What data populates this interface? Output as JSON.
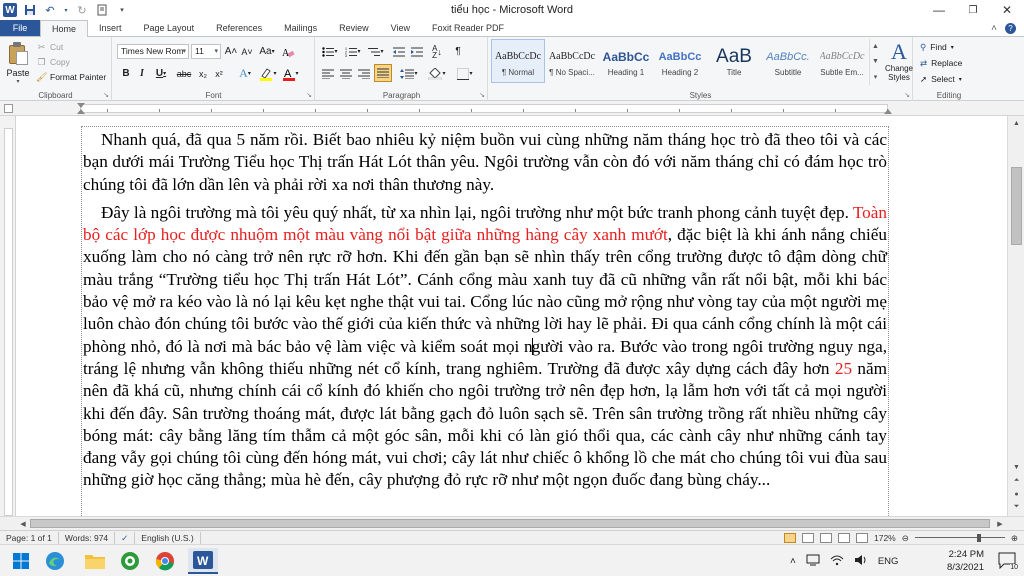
{
  "window": {
    "title": "tiểu học - Microsoft Word",
    "minimize": "—",
    "maximize": "❐",
    "close": "✕"
  },
  "qat": {
    "save_icon": "save-icon",
    "undo_icon": "undo-icon",
    "redo_icon": "redo-icon"
  },
  "tabs": [
    {
      "label": "File"
    },
    {
      "label": "Home"
    },
    {
      "label": "Insert"
    },
    {
      "label": "Page Layout"
    },
    {
      "label": "References"
    },
    {
      "label": "Mailings"
    },
    {
      "label": "Review"
    },
    {
      "label": "View"
    },
    {
      "label": "Foxit Reader PDF"
    }
  ],
  "clipboard": {
    "paste": "Paste",
    "cut": "Cut",
    "copy": "Copy",
    "format_painter": "Format Painter",
    "group_label": "Clipboard"
  },
  "font": {
    "name": "Times New Rom",
    "size": "11",
    "bold": "B",
    "italic": "I",
    "underline": "U",
    "strikethrough": "abc",
    "subscript": "x₂",
    "superscript": "x²",
    "grow": "A˄",
    "shrink": "A˅",
    "change_case": "Aa",
    "group_label": "Font"
  },
  "paragraph": {
    "group_label": "Paragraph",
    "pilcrow": "¶"
  },
  "styles": {
    "items": [
      {
        "preview": "AaBbCcDc",
        "name": "¶ Normal"
      },
      {
        "preview": "AaBbCcDc",
        "name": "¶ No Spaci..."
      },
      {
        "preview": "AaBbCc",
        "name": "Heading 1"
      },
      {
        "preview": "AaBbCc",
        "name": "Heading 2"
      },
      {
        "preview": "AaB",
        "name": "Title"
      },
      {
        "preview": "AaBbCc.",
        "name": "Subtitle"
      },
      {
        "preview": "AaBbCcDc",
        "name": "Subtle Em..."
      }
    ],
    "change_styles": "Change Styles",
    "group_label": "Styles"
  },
  "editing": {
    "find": "Find",
    "replace": "Replace",
    "select": "Select",
    "group_label": "Editing"
  },
  "document": {
    "p1": "Nhanh quá, đã qua 5 năm rồi. Biết bao nhiêu kỷ niệm buồn vui cùng những năm tháng học trò đã theo tôi và các bạn dưới mái Trường Tiểu học Thị trấn Hát Lót thân yêu. Ngôi trường vẫn còn đó với năm tháng chỉ có đám học trò chúng tôi đã lớn dần lên và phải rời xa nơi thân thương này.",
    "p2_a": "Đây là ngôi trường mà tôi yêu quý nhất, từ xa nhìn lại, ngôi trường như một bức tranh phong cảnh tuyệt đẹp. ",
    "p2_red": "Toàn bộ các lớp học được nhuộm một màu vàng nổi bật giữa những hàng cây xanh mướt",
    "p2_b": ", đặc biệt là khi ánh nắng chiếu xuống làm cho nó càng trở nên rực rỡ hơn. Khi đến gần bạn sẽ nhìn thấy trên cổng trường được tô đậm dòng chữ màu trắng “Trường tiểu học Thị trấn Hát Lót”. Cánh cổng màu xanh tuy đã cũ những vẫn rất nổi bật, mỗi khi bác bảo vệ mở ra kéo vào là nó lại kêu kẹt nghe thật vui tai. Cổng lúc nào cũng mở rộng như vòng tay của một người mẹ luôn chào đón chúng tôi bước vào thế giới của kiến thức và những lời hay lẽ phải. Đi qua cánh cổng chính là một cái phòng nhỏ, đó là nơi mà bác bảo vệ làm việc và kiểm soát mọi n",
    "p2_c": "gười vào ra. Bước vào trong ngôi trường nguy nga, tráng lệ nhưng vẫn không thiếu những nét cổ kính, trang nghiêm. Trường đã được xây dựng cách đây hơn ",
    "p2_num": "25",
    "p2_d": " năm nên đã khá cũ, nhưng chính cái cổ kính đó khiến cho ngôi trường trở nên đẹp hơn, lạ lẫm hơn với tất cả mọi người khi đến đây. Sân trường thoáng mát, được lát bằng gạch đỏ luôn sạch sẽ. Trên sân trường trồng rất nhiều những cây bóng mát: cây bằng lăng tím thẫm cả một góc sân, mỗi khi có làn gió thổi qua, các cành cây như những cánh tay đang vẫy gọi chúng tôi cùng đến hóng mát, vui chơi; cây lát như chiếc ô khổng lồ che mát cho chúng tôi vui đùa sau những giờ học căng thẳng; mùa hè đến, cây phượng đỏ rực rỡ như một ngọn đuốc đang bùng cháy..."
  },
  "status": {
    "page": "Page: 1 of 1",
    "words": "Words: 974",
    "language": "English (U.S.)",
    "zoom": "172%",
    "zoom_value": 0.72
  },
  "taskbar": {
    "time": "2:24 PM",
    "date": "8/3/2021",
    "lang": "ENG",
    "notifications": "10"
  },
  "colors": {
    "accent": "#2b579a",
    "highlight_text": "#e81e1e"
  }
}
